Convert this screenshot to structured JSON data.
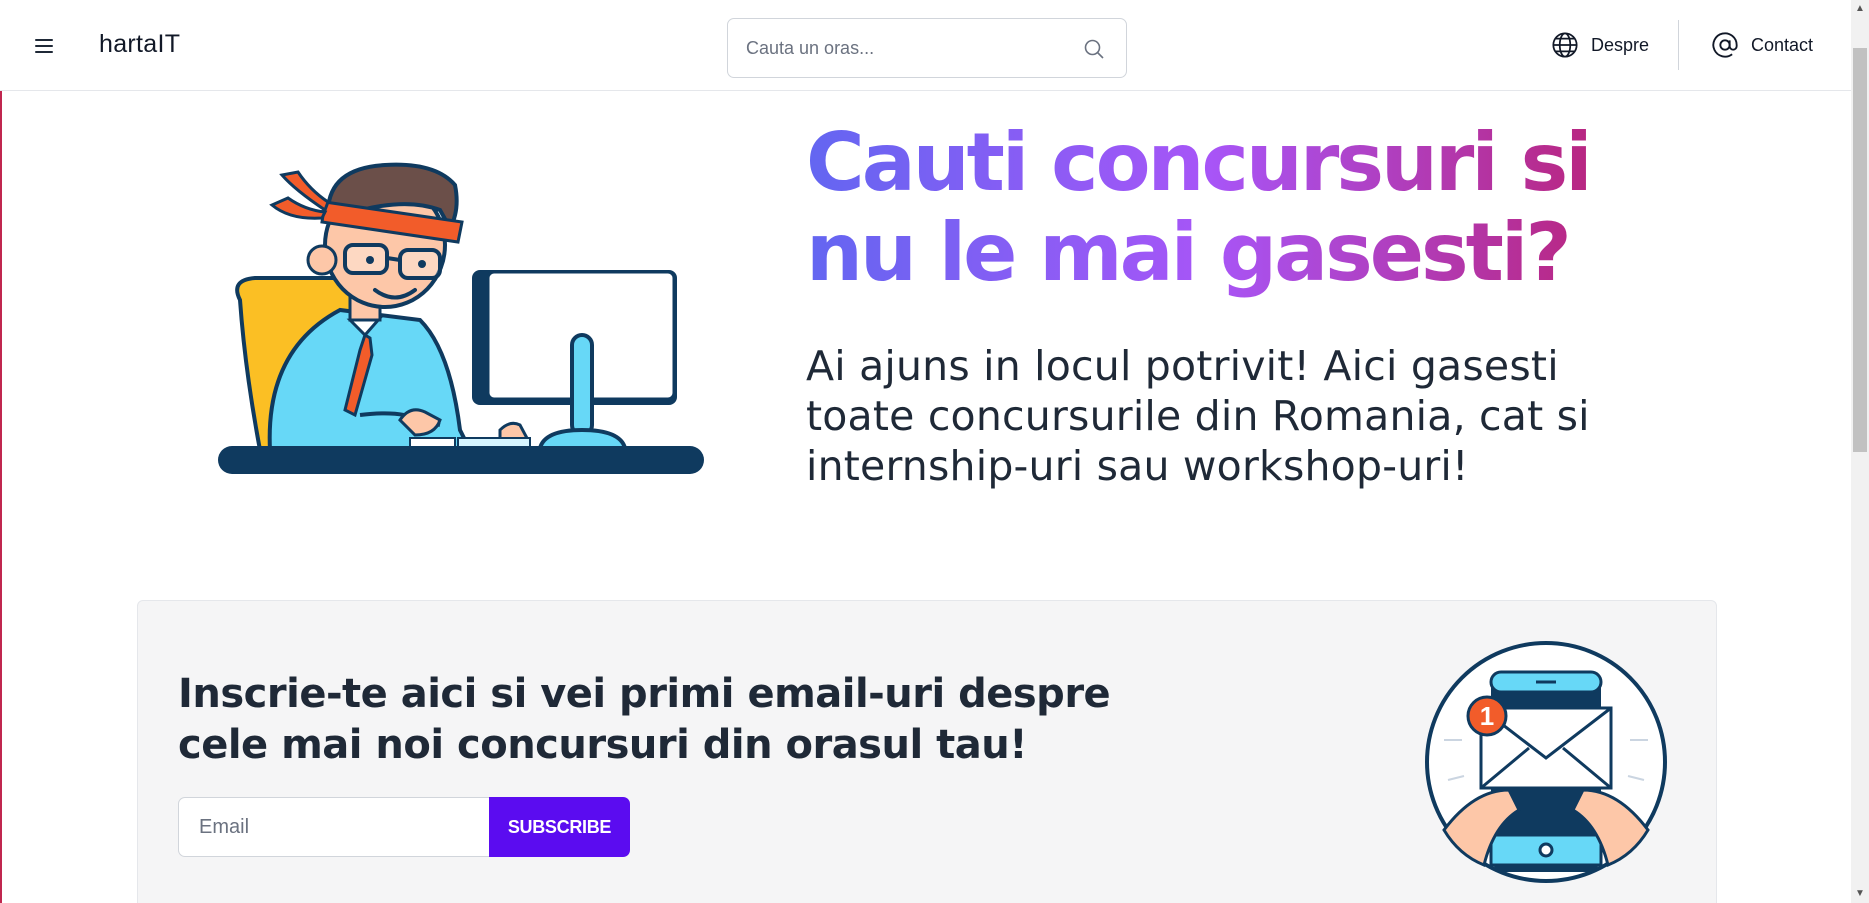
{
  "header": {
    "brand": "hartaIT",
    "search_placeholder": "Cauta un oras...",
    "nav": [
      {
        "label": "Despre",
        "icon": "globe-icon"
      },
      {
        "label": "Contact",
        "icon": "at-sign-icon"
      }
    ]
  },
  "hero": {
    "title_line1": "Cauti concursuri si",
    "title_line2": "nu le mai gasesti?",
    "subtitle_line1": "Ai ajuns in locul potrivit! Aici gasesti",
    "subtitle_line2": "toate concursurile din Romania, cat si",
    "subtitle_line3": "internship-uri sau workshop-uri!"
  },
  "subscribe": {
    "title_line1": "Inscrie-te aici si vei primi email-uri despre",
    "title_line2": "cele mai noi concursuri din orasul tau!",
    "email_placeholder": "Email",
    "button_label": "SUBSCRIBE",
    "notification_count": "1"
  },
  "colors": {
    "accent": "#5b0cf0",
    "gradient": [
      "#6366f1",
      "#a855f7",
      "#be185d"
    ],
    "text": "#1f2937"
  }
}
